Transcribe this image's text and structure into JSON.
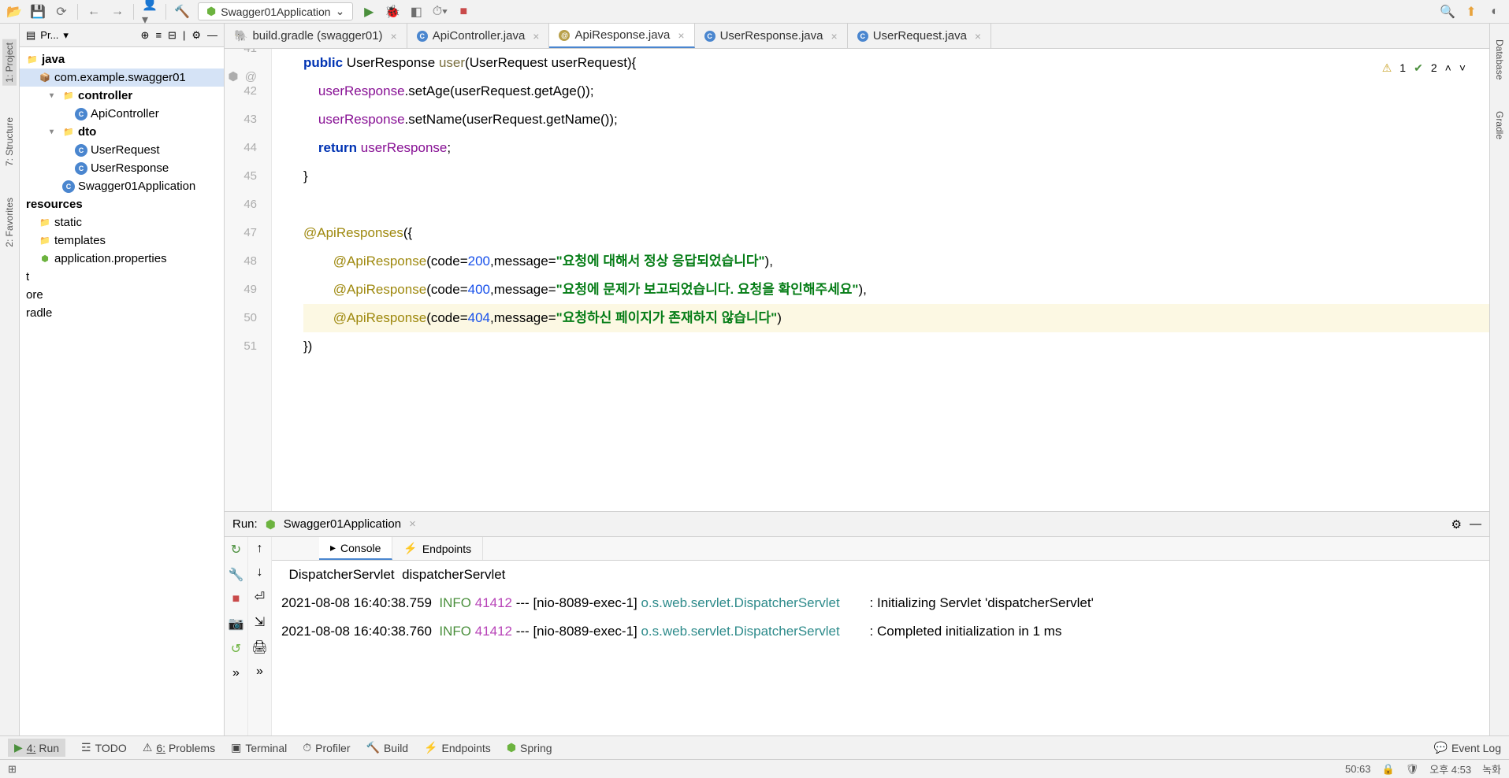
{
  "toolbar": {
    "run_config": "Swagger01Application"
  },
  "left_bar": {
    "project": "1: Project",
    "structure": "7: Structure",
    "favorites": "2: Favorites"
  },
  "right_bar": {
    "database": "Database",
    "gradle": "Gradle"
  },
  "project": {
    "header": "Pr...",
    "tree": {
      "java": "java",
      "package": "com.example.swagger01",
      "controller": "controller",
      "apiController": "ApiController",
      "dto": "dto",
      "userRequest": "UserRequest",
      "userResponse": "UserResponse",
      "swaggerApp": "Swagger01Application",
      "resources": "resources",
      "static": "static",
      "templates": "templates",
      "appProps": "application.properties",
      "t": "t",
      "ore": "ore",
      "radle": "radle"
    }
  },
  "tabs": [
    {
      "label": "build.gradle (swagger01)",
      "icon": "gradle"
    },
    {
      "label": "ApiController.java",
      "icon": "c"
    },
    {
      "label": "ApiResponse.java",
      "icon": "a",
      "active": true
    },
    {
      "label": "UserResponse.java",
      "icon": "c"
    },
    {
      "label": "UserRequest.java",
      "icon": "c"
    }
  ],
  "editor": {
    "status": {
      "warn": "1",
      "check": "2"
    },
    "lines": {
      "41": {
        "t1": "public",
        "t2": " UserResponse ",
        "m": "user",
        "t3": "(UserRequest userRequest){"
      },
      "42": {
        "f": "userResponse",
        "t1": ".setAge(userRequest.getAge());"
      },
      "43": {
        "f": "userResponse",
        "t1": ".setName(userRequest.getName());"
      },
      "44": {
        "k": "return",
        "f": " userResponse",
        "t": ";"
      },
      "45": {
        "t": "}"
      },
      "46": {
        "t": ""
      },
      "47": {
        "a": "@ApiResponses",
        "t": "({"
      },
      "48": {
        "a": "@ApiResponse",
        "t1": "(code=",
        "n": "200",
        "t2": ",message=",
        "s": "\"요청에 대해서 정상 응답되었습니다\"",
        "t3": "),"
      },
      "49": {
        "a": "@ApiResponse",
        "t1": "(code=",
        "n": "400",
        "t2": ",message=",
        "s": "\"요청에 문제가 보고되었습니다. 요청을 확인해주세요\"",
        "t3": "),"
      },
      "50": {
        "a": "@ApiResponse",
        "t1": "(code=",
        "n": "404",
        "t2": ",message=",
        "s": "\"요청하신 페이지가 존재하지 않습니다\"",
        "t3": ")"
      },
      "51": {
        "t": "})"
      }
    }
  },
  "run": {
    "title": "Run:",
    "app": "Swagger01Application",
    "console_tab": "Console",
    "endpoints_tab": "Endpoints",
    "lines": [
      {
        "pre": "  DispatcherServlet  dispatcherServlet"
      },
      {
        "ts": "2021-08-08 16:40:38.759  ",
        "lvl": "INFO ",
        "pid": "41412",
        "mid": " --- [nio-8089-exec-1] ",
        "cls": "o.s.web.servlet.DispatcherServlet",
        "msg": "        : Initializing Servlet 'dispatcherServlet'"
      },
      {
        "ts": "2021-08-08 16:40:38.760  ",
        "lvl": "INFO ",
        "pid": "41412",
        "mid": " --- [nio-8089-exec-1] ",
        "cls": "o.s.web.servlet.DispatcherServlet",
        "msg": "        : Completed initialization in 1 ms"
      }
    ]
  },
  "bottom": {
    "run": "Run",
    "run_key": "4:",
    "todo": "TODO",
    "problems": "Problems",
    "problems_key": "6:",
    "terminal": "Terminal",
    "profiler": "Profiler",
    "build": "Build",
    "endpoints": "Endpoints",
    "spring": "Spring",
    "event_log": "Event Log"
  },
  "status": {
    "pos": "50:63",
    "time": "오후 4:53",
    "rec": "녹화"
  }
}
